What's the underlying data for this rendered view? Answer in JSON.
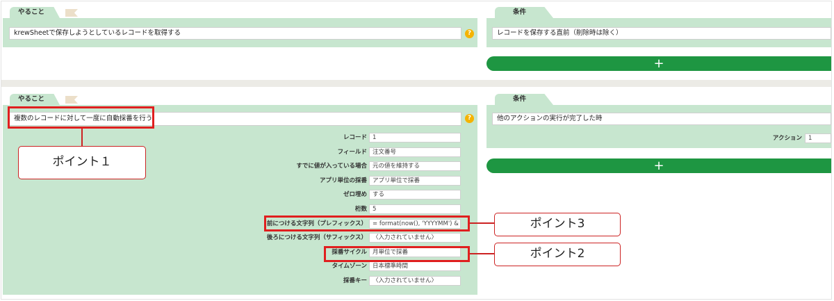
{
  "section1": {
    "todo_tab": "やること",
    "cond_tab": "条件",
    "todo_text": "krewSheetで保存しようとしているレコードを取得する",
    "cond_text": "レコードを保存する直前（削除時は除く）",
    "add_label": "+",
    "help_label": "?"
  },
  "section2": {
    "todo_tab": "やること",
    "cond_tab": "条件",
    "todo_text": "複数のレコードに対して一度に自動採番を行う",
    "cond_text": "他のアクションの実行が完了した時",
    "action_label": "アクション",
    "action_value": "1",
    "add_label": "+",
    "help_label": "?",
    "fields": [
      {
        "label": "レコード",
        "value": "1"
      },
      {
        "label": "フィールド",
        "value": "注文番号"
      },
      {
        "label": "すでに値が入っている場合",
        "value": "元の値を維持する"
      },
      {
        "label": "アプリ単位の採番",
        "value": "アプリ単位で採番"
      },
      {
        "label": "ゼロ埋め",
        "value": "する"
      },
      {
        "label": "桁数",
        "value": "5"
      },
      {
        "label": "前につける文字列（プレフィックス）",
        "value": "= format(now(), 'YYYYMM') & \"-\""
      },
      {
        "label": "後ろにつける文字列（サフィックス）",
        "value": "〈入力されていません〉"
      },
      {
        "label": "採番サイクル",
        "value": "月単位で採番"
      },
      {
        "label": "タイムゾーン",
        "value": "日本標準時間"
      },
      {
        "label": "採番キー",
        "value": "〈入力されていません〉"
      }
    ]
  },
  "callouts": {
    "point1": "ポイント１",
    "point2": "ポイント2",
    "point3": "ポイント3"
  },
  "colors": {
    "panel_green": "#c7e6cf",
    "button_green": "#1e9642",
    "highlight_red": "#e01f1f",
    "help_orange": "#f5b300"
  }
}
